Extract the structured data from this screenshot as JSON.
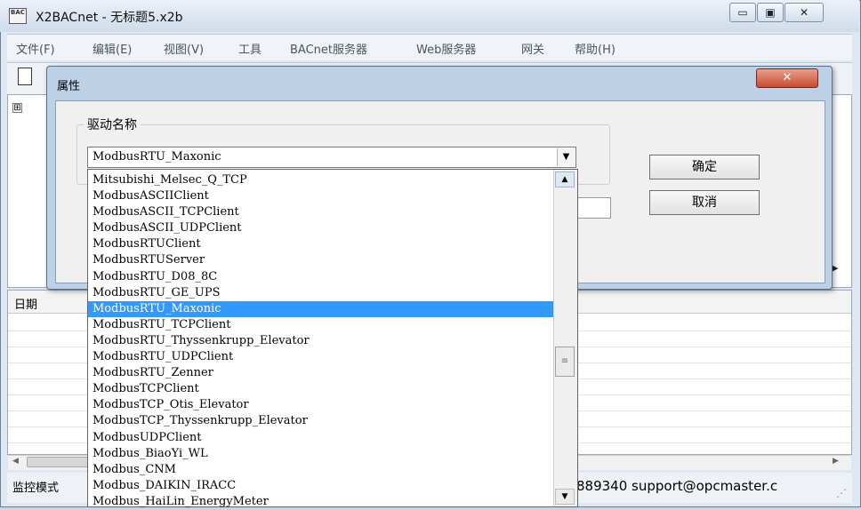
{
  "window": {
    "title": "X2BACnet - 无标题5.x2b",
    "app_icon_text": "BAC",
    "minimize_glyph": "▭",
    "maximize_glyph": "▣",
    "close_glyph": "✕"
  },
  "menu": {
    "items": [
      "文件(F)",
      "编辑(E)",
      "视图(V)",
      "工具",
      "BACnet服务器",
      "Web服务器",
      "网关",
      "帮助(H)"
    ]
  },
  "tree": {
    "expander": "⊞"
  },
  "log": {
    "col_date": "日期"
  },
  "status": {
    "mode": "监控模式",
    "contact": "889340 support@opcmaster.c"
  },
  "dialog": {
    "title": "属性",
    "group_label": "驱动名称",
    "selected_driver": "ModbusRTU_Maxonic",
    "ok_label": "确定",
    "cancel_label": "取消",
    "close_glyph": "✕"
  },
  "dropdown": {
    "options": [
      "Mitsubishi_Melsec_Q_TCP",
      "ModbusASCIIClient",
      "ModbusASCII_TCPClient",
      "ModbusASCII_UDPClient",
      "ModbusRTUClient",
      "ModbusRTUServer",
      "ModbusRTU_D08_8C",
      "ModbusRTU_GE_UPS",
      "ModbusRTU_Maxonic",
      "ModbusRTU_TCPClient",
      "ModbusRTU_Thyssenkrupp_Elevator",
      "ModbusRTU_UDPClient",
      "ModbusRTU_Zenner",
      "ModbusTCPClient",
      "ModbusTCP_Otis_Elevator",
      "ModbusTCP_Thyssenkrupp_Elevator",
      "ModbusUDPClient",
      "Modbus_BiaoYi_WL",
      "Modbus_CNM",
      "Modbus_DAIKIN_IRACC",
      "Modbus_HaiLin_EnergyMeter"
    ],
    "selected_index": 8,
    "selection_color": "#3399ff"
  }
}
